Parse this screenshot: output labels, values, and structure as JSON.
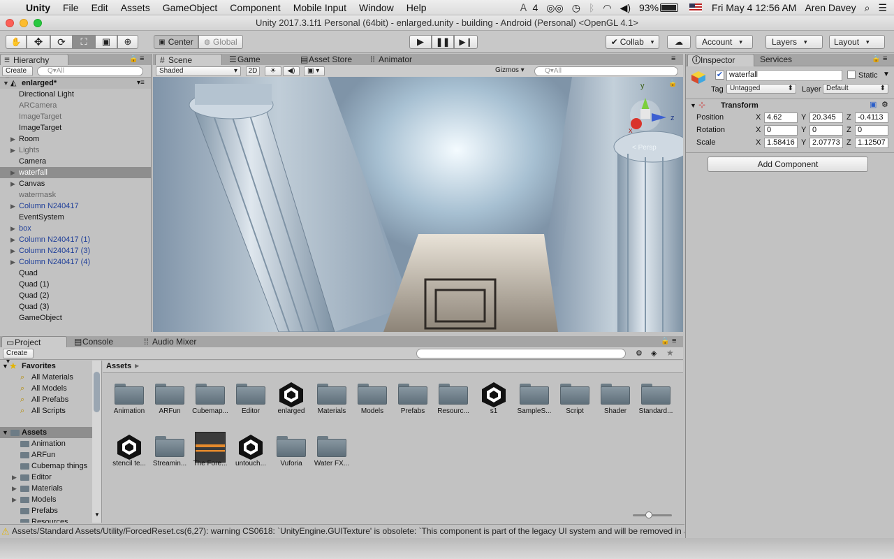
{
  "menubar": {
    "app": "Unity",
    "items": [
      "File",
      "Edit",
      "Assets",
      "GameObject",
      "Component",
      "Mobile Input",
      "Window",
      "Help"
    ],
    "status": {
      "badge": "4",
      "battery": "93%",
      "datetime": "Fri May 4  12:56 AM",
      "user": "Aren Davey"
    }
  },
  "window": {
    "title": "Unity 2017.3.1f1 Personal (64bit) - enlarged.unity - building - Android (Personal) <OpenGL 4.1>"
  },
  "toolbar": {
    "pivot": "Center",
    "space": "Global",
    "collab": "Collab",
    "account": "Account",
    "layers": "Layers",
    "layout": "Layout"
  },
  "hierarchy": {
    "tab": "Hierarchy",
    "create": "Create",
    "search_placeholder": "Q▾All",
    "scene_name": "enlarged*",
    "items": [
      {
        "label": "Directional Light",
        "style": "normal",
        "arrow": false
      },
      {
        "label": "ARCamera",
        "style": "gray",
        "arrow": false
      },
      {
        "label": "ImageTarget",
        "style": "gray",
        "arrow": false
      },
      {
        "label": "ImageTarget",
        "style": "normal",
        "arrow": false
      },
      {
        "label": "Room",
        "style": "normal",
        "arrow": true
      },
      {
        "label": "Lights",
        "style": "gray",
        "arrow": true
      },
      {
        "label": "Camera",
        "style": "normal",
        "arrow": false
      },
      {
        "label": "waterfall",
        "style": "selected",
        "arrow": true
      },
      {
        "label": "Canvas",
        "style": "normal",
        "arrow": true
      },
      {
        "label": "watermask",
        "style": "gray",
        "arrow": false
      },
      {
        "label": "Column N240417",
        "style": "blue",
        "arrow": true
      },
      {
        "label": "EventSystem",
        "style": "normal",
        "arrow": false
      },
      {
        "label": "box",
        "style": "blue",
        "arrow": true
      },
      {
        "label": "Column N240417 (1)",
        "style": "blue",
        "arrow": true
      },
      {
        "label": "Column N240417 (3)",
        "style": "blue",
        "arrow": true
      },
      {
        "label": "Column N240417 (4)",
        "style": "blue",
        "arrow": true
      },
      {
        "label": "Quad",
        "style": "normal",
        "arrow": false
      },
      {
        "label": "Quad (1)",
        "style": "normal",
        "arrow": false
      },
      {
        "label": "Quad (2)",
        "style": "normal",
        "arrow": false
      },
      {
        "label": "Quad (3)",
        "style": "normal",
        "arrow": false
      },
      {
        "label": "GameObject",
        "style": "normal",
        "arrow": false
      }
    ]
  },
  "scene": {
    "tabs": [
      "Scene",
      "Game",
      "Asset Store",
      "Animator"
    ],
    "shading": "Shaded",
    "mode2d": "2D",
    "gizmos": "Gizmos",
    "search_placeholder": "Q▾All",
    "gizmo_label": "< Persp",
    "axes": {
      "y": "y",
      "x": "x",
      "z": "z"
    }
  },
  "inspector": {
    "tabs": [
      "Inspector",
      "Services"
    ],
    "object_name": "waterfall",
    "static_label": "Static",
    "tag_label": "Tag",
    "tag_value": "Untagged",
    "layer_label": "Layer",
    "layer_value": "Default",
    "component": "Transform",
    "rows": [
      {
        "label": "Position",
        "x": "4.62",
        "y": "20.345",
        "z": "-0.4113"
      },
      {
        "label": "Rotation",
        "x": "0",
        "y": "0",
        "z": "0"
      },
      {
        "label": "Scale",
        "x": "1.58416",
        "y": "2.07773",
        "z": "1.12507"
      }
    ],
    "axis_labels": {
      "x": "X",
      "y": "Y",
      "z": "Z"
    },
    "add_component": "Add Component"
  },
  "project": {
    "tabs": [
      "Project",
      "Console",
      "Audio Mixer"
    ],
    "create": "Create",
    "favorites_label": "Favorites",
    "favorites": [
      "All Materials",
      "All Models",
      "All Prefabs",
      "All Scripts"
    ],
    "assets_label": "Assets",
    "assets_tree": [
      {
        "label": "Animation",
        "arrow": false
      },
      {
        "label": "ARFun",
        "arrow": false
      },
      {
        "label": "Cubemap things",
        "arrow": false
      },
      {
        "label": "Editor",
        "arrow": true
      },
      {
        "label": "Materials",
        "arrow": true
      },
      {
        "label": "Models",
        "arrow": true
      },
      {
        "label": "Prefabs",
        "arrow": false
      },
      {
        "label": "Resources",
        "arrow": false
      }
    ],
    "breadcrumb": "Assets",
    "grid": [
      {
        "label": "Animation",
        "type": "folder"
      },
      {
        "label": "ARFun",
        "type": "folder"
      },
      {
        "label": "Cubemap...",
        "type": "folder"
      },
      {
        "label": "Editor",
        "type": "folder"
      },
      {
        "label": "enlarged",
        "type": "unity"
      },
      {
        "label": "Materials",
        "type": "folder"
      },
      {
        "label": "Models",
        "type": "folder"
      },
      {
        "label": "Prefabs",
        "type": "folder"
      },
      {
        "label": "Resourc...",
        "type": "folder"
      },
      {
        "label": "s1",
        "type": "unity"
      },
      {
        "label": "SampleS...",
        "type": "folder"
      },
      {
        "label": "Script",
        "type": "folder"
      },
      {
        "label": "Shader",
        "type": "folder"
      },
      {
        "label": "Standard...",
        "type": "folder"
      },
      {
        "label": "stencil te...",
        "type": "unity"
      },
      {
        "label": "Streamin...",
        "type": "folder"
      },
      {
        "label": "The Fore...",
        "type": "texture"
      },
      {
        "label": "untouch...",
        "type": "unity"
      },
      {
        "label": "Vuforia",
        "type": "folder"
      },
      {
        "label": "Water FX...",
        "type": "folder"
      }
    ]
  },
  "statusbar": {
    "message": "Assets/Standard Assets/Utility/ForcedReset.cs(6,27): warning CS0618: `UnityEngine.GUITexture' is obsolete: `This component is part of the legacy UI system and will be removed in a future release.'"
  },
  "colors": {
    "accent_blue": "#1f3f99",
    "selection": "#8e8e8e",
    "warning": "#f2c200"
  }
}
